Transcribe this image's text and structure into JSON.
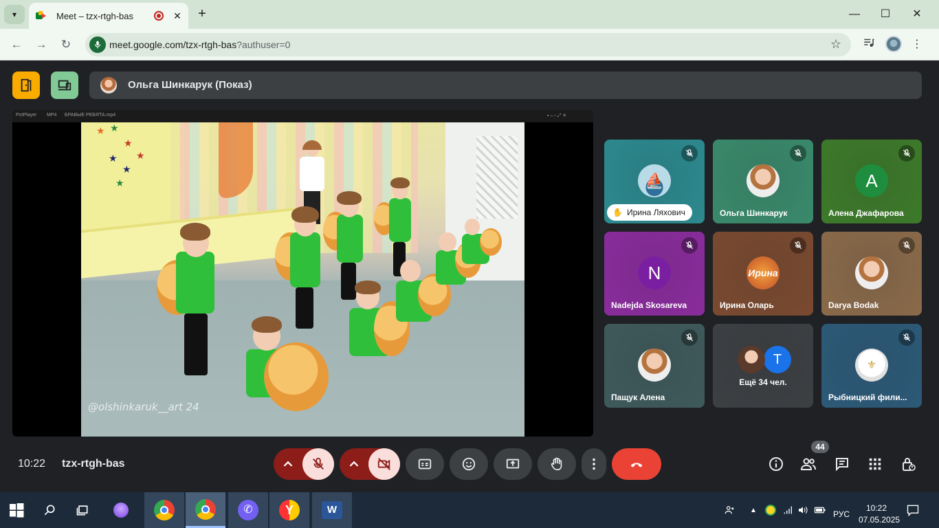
{
  "browser": {
    "tab_title": "Meet – tzx-rtgh-bas",
    "url_main": "meet.google.com/tzx-rtgh-bas",
    "url_rest": "?authuser=0"
  },
  "meet": {
    "presenter_label": "Ольга Шинкарук (Показ)",
    "player_title_left": "PotPlayer",
    "player_format": "MP4",
    "player_file": "БРАВЫЕ РЕБЯТА.mp4",
    "watermark": "@olshinkaruk__art 24",
    "participants": [
      {
        "name": "Ирина Ляхович",
        "initial": "",
        "bg": "#2c8a8f",
        "avatar_kind": "ship",
        "hand": true
      },
      {
        "name": "Ольга Шинкарук",
        "initial": "",
        "bg": "#3a8a6c",
        "avatar_kind": "photo",
        "hand": false
      },
      {
        "name": "Алена Джафарова",
        "initial": "A",
        "bg": "#3d7a2a",
        "avatar_kind": "letter",
        "avatar_bg": "#1e8e3e",
        "hand": false
      },
      {
        "name": "Nadejda Skosareva",
        "initial": "N",
        "bg": "#8a2c9c",
        "avatar_kind": "letter",
        "avatar_bg": "#7b1fa2",
        "hand": false
      },
      {
        "name": "Ирина Оларь",
        "initial": "Ирина",
        "bg": "#7a4a30",
        "avatar_kind": "text",
        "hand": false
      },
      {
        "name": "Darya Bodak",
        "initial": "",
        "bg": "#8a6a4a",
        "avatar_kind": "photo",
        "hand": false
      },
      {
        "name": "Пащук Алена",
        "initial": "",
        "bg": "#3f5a5c",
        "avatar_kind": "photo",
        "hand": false
      },
      {
        "name": "Ещё 34 чел.",
        "initial": "T",
        "bg": "#3c4043",
        "avatar_kind": "more",
        "hand": false
      },
      {
        "name": "Рыбницкий фили...",
        "initial": "",
        "bg": "#2c5a78",
        "avatar_kind": "logo",
        "hand": false
      }
    ],
    "clock": "10:22",
    "meeting_code": "tzx-rtgh-bas",
    "people_count": "44"
  },
  "taskbar": {
    "lang": "РУС",
    "time": "10:22",
    "date": "07.05.2025"
  },
  "colors": {
    "end_call": "#ea4335",
    "muted_red": "#8c1d18",
    "control_gray": "#3c4043"
  }
}
